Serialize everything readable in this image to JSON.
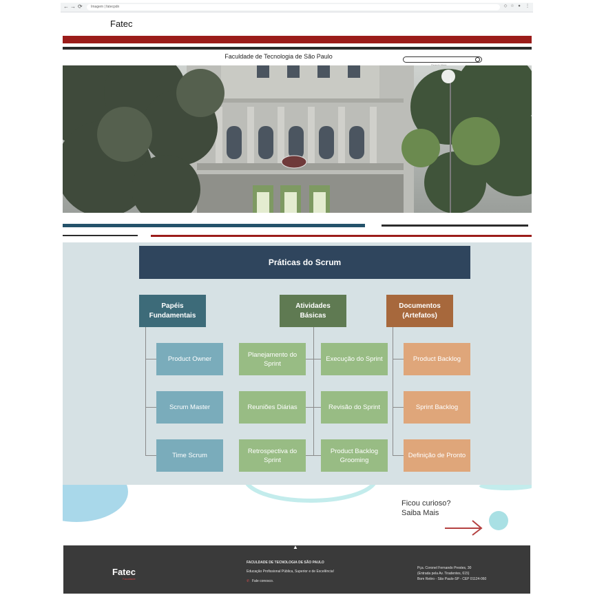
{
  "browser": {
    "url": "Imagem | fatecpdn",
    "back_glyph": "←",
    "forward_glyph": "→",
    "reload_glyph": "⟳"
  },
  "header": {
    "brand": "Fatec",
    "institution": "Faculdade de Tecnologia de São Paulo",
    "search_placeholder": "Search Here"
  },
  "scrum": {
    "title": "Práticas do Scrum",
    "columns": {
      "papeis": {
        "line1": "Papéis",
        "line2": "Fundamentais"
      },
      "atividades": {
        "line1": "Atividades",
        "line2": "Básicas"
      },
      "documentos": {
        "line1": "Documentos",
        "line2": "(Artefatos)"
      }
    },
    "roles": [
      "Product Owner",
      "Scrum Master",
      "Time Scrum"
    ],
    "activities_left": [
      "Planejamento do Sprint",
      "Reuniões Diárias",
      "Retrospectiva do Sprint"
    ],
    "activities_right": [
      "Execução do Sprint",
      "Revisão do Sprint",
      "Product Backlog Grooming"
    ],
    "artifacts": [
      "Product Backlog",
      "Sprint Backlog",
      "Definição de Pronto"
    ]
  },
  "cta": {
    "line1": "Ficou curioso?",
    "line2": "Saiba Mais",
    "arrow": "→"
  },
  "footer": {
    "brand": "Fatec",
    "brand_sub": "Faculdade",
    "title": "FACULDADE DE TECNOLOGIA DE SÃO PAULO",
    "tagline": "Educação Profissional Pública, Superior e de Excelência!",
    "contact": "Fale conosco.",
    "address1": "Pça. Coronel Fernando Prestes, 30",
    "address2": "(Entrada pela Av. Tiradentes, 615)",
    "address3": "Bom Retiro - São Paulo-SP - CEP 01124-060",
    "up_glyph": "▲"
  },
  "colors": {
    "red": "#9b1c1a",
    "dark": "#2b2b2b",
    "navy": "#2f455d",
    "teal_header": "#3d6b79",
    "green_header": "#5f7a52",
    "orange_header": "#a7683c"
  }
}
